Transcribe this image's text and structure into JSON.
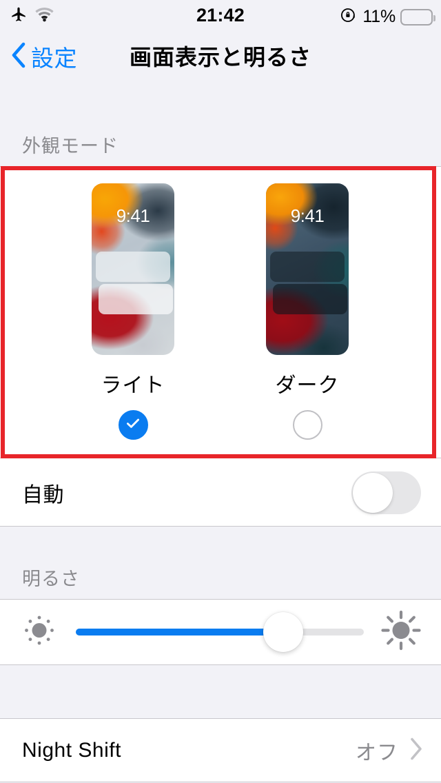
{
  "status_bar": {
    "airplane_icon": "airplane-icon",
    "wifi_icon": "wifi-icon",
    "time": "21:42",
    "rotation_lock_icon": "rotation-lock-icon",
    "battery_percent": "11%",
    "battery_level": 11,
    "battery_color": "#f03b30"
  },
  "nav": {
    "back_icon": "chevron-left-icon",
    "back_label": "設定",
    "title": "画面表示と明るさ",
    "accent_color": "#0a84ff"
  },
  "appearance": {
    "header": "外観モード",
    "options": [
      {
        "label": "ライト",
        "preview_time": "9:41",
        "selected": true
      },
      {
        "label": "ダーク",
        "preview_time": "9:41",
        "selected": false
      }
    ],
    "auto_label": "自動",
    "auto_enabled": false
  },
  "brightness": {
    "header": "明るさ",
    "low_icon": "sun-small-icon",
    "high_icon": "sun-large-icon",
    "value": 72,
    "fill_color": "#0a7cf0"
  },
  "night_shift": {
    "label": "Night Shift",
    "value": "オフ",
    "chevron_icon": "chevron-right-icon"
  },
  "annotation": {
    "color": "#e8252a",
    "target": "外観モード"
  }
}
